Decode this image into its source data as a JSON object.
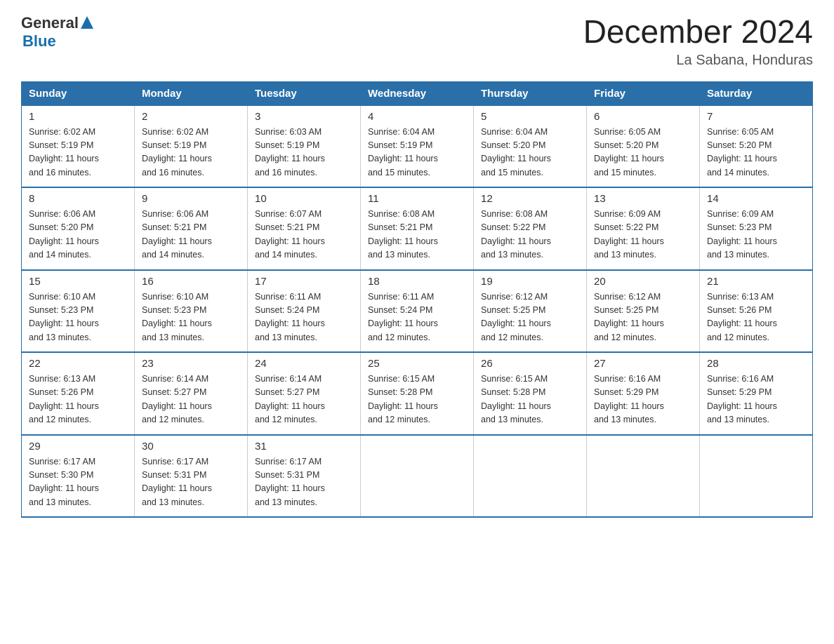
{
  "header": {
    "title": "December 2024",
    "subtitle": "La Sabana, Honduras",
    "logo_general": "General",
    "logo_blue": "Blue"
  },
  "days_of_week": [
    "Sunday",
    "Monday",
    "Tuesday",
    "Wednesday",
    "Thursday",
    "Friday",
    "Saturday"
  ],
  "weeks": [
    [
      {
        "day": "1",
        "sunrise": "6:02 AM",
        "sunset": "5:19 PM",
        "daylight": "11 hours and 16 minutes."
      },
      {
        "day": "2",
        "sunrise": "6:02 AM",
        "sunset": "5:19 PM",
        "daylight": "11 hours and 16 minutes."
      },
      {
        "day": "3",
        "sunrise": "6:03 AM",
        "sunset": "5:19 PM",
        "daylight": "11 hours and 16 minutes."
      },
      {
        "day": "4",
        "sunrise": "6:04 AM",
        "sunset": "5:19 PM",
        "daylight": "11 hours and 15 minutes."
      },
      {
        "day": "5",
        "sunrise": "6:04 AM",
        "sunset": "5:20 PM",
        "daylight": "11 hours and 15 minutes."
      },
      {
        "day": "6",
        "sunrise": "6:05 AM",
        "sunset": "5:20 PM",
        "daylight": "11 hours and 15 minutes."
      },
      {
        "day": "7",
        "sunrise": "6:05 AM",
        "sunset": "5:20 PM",
        "daylight": "11 hours and 14 minutes."
      }
    ],
    [
      {
        "day": "8",
        "sunrise": "6:06 AM",
        "sunset": "5:20 PM",
        "daylight": "11 hours and 14 minutes."
      },
      {
        "day": "9",
        "sunrise": "6:06 AM",
        "sunset": "5:21 PM",
        "daylight": "11 hours and 14 minutes."
      },
      {
        "day": "10",
        "sunrise": "6:07 AM",
        "sunset": "5:21 PM",
        "daylight": "11 hours and 14 minutes."
      },
      {
        "day": "11",
        "sunrise": "6:08 AM",
        "sunset": "5:21 PM",
        "daylight": "11 hours and 13 minutes."
      },
      {
        "day": "12",
        "sunrise": "6:08 AM",
        "sunset": "5:22 PM",
        "daylight": "11 hours and 13 minutes."
      },
      {
        "day": "13",
        "sunrise": "6:09 AM",
        "sunset": "5:22 PM",
        "daylight": "11 hours and 13 minutes."
      },
      {
        "day": "14",
        "sunrise": "6:09 AM",
        "sunset": "5:23 PM",
        "daylight": "11 hours and 13 minutes."
      }
    ],
    [
      {
        "day": "15",
        "sunrise": "6:10 AM",
        "sunset": "5:23 PM",
        "daylight": "11 hours and 13 minutes."
      },
      {
        "day": "16",
        "sunrise": "6:10 AM",
        "sunset": "5:23 PM",
        "daylight": "11 hours and 13 minutes."
      },
      {
        "day": "17",
        "sunrise": "6:11 AM",
        "sunset": "5:24 PM",
        "daylight": "11 hours and 13 minutes."
      },
      {
        "day": "18",
        "sunrise": "6:11 AM",
        "sunset": "5:24 PM",
        "daylight": "11 hours and 12 minutes."
      },
      {
        "day": "19",
        "sunrise": "6:12 AM",
        "sunset": "5:25 PM",
        "daylight": "11 hours and 12 minutes."
      },
      {
        "day": "20",
        "sunrise": "6:12 AM",
        "sunset": "5:25 PM",
        "daylight": "11 hours and 12 minutes."
      },
      {
        "day": "21",
        "sunrise": "6:13 AM",
        "sunset": "5:26 PM",
        "daylight": "11 hours and 12 minutes."
      }
    ],
    [
      {
        "day": "22",
        "sunrise": "6:13 AM",
        "sunset": "5:26 PM",
        "daylight": "11 hours and 12 minutes."
      },
      {
        "day": "23",
        "sunrise": "6:14 AM",
        "sunset": "5:27 PM",
        "daylight": "11 hours and 12 minutes."
      },
      {
        "day": "24",
        "sunrise": "6:14 AM",
        "sunset": "5:27 PM",
        "daylight": "11 hours and 12 minutes."
      },
      {
        "day": "25",
        "sunrise": "6:15 AM",
        "sunset": "5:28 PM",
        "daylight": "11 hours and 12 minutes."
      },
      {
        "day": "26",
        "sunrise": "6:15 AM",
        "sunset": "5:28 PM",
        "daylight": "11 hours and 13 minutes."
      },
      {
        "day": "27",
        "sunrise": "6:16 AM",
        "sunset": "5:29 PM",
        "daylight": "11 hours and 13 minutes."
      },
      {
        "day": "28",
        "sunrise": "6:16 AM",
        "sunset": "5:29 PM",
        "daylight": "11 hours and 13 minutes."
      }
    ],
    [
      {
        "day": "29",
        "sunrise": "6:17 AM",
        "sunset": "5:30 PM",
        "daylight": "11 hours and 13 minutes."
      },
      {
        "day": "30",
        "sunrise": "6:17 AM",
        "sunset": "5:31 PM",
        "daylight": "11 hours and 13 minutes."
      },
      {
        "day": "31",
        "sunrise": "6:17 AM",
        "sunset": "5:31 PM",
        "daylight": "11 hours and 13 minutes."
      },
      null,
      null,
      null,
      null
    ]
  ],
  "labels": {
    "sunrise": "Sunrise:",
    "sunset": "Sunset:",
    "daylight": "Daylight:"
  }
}
